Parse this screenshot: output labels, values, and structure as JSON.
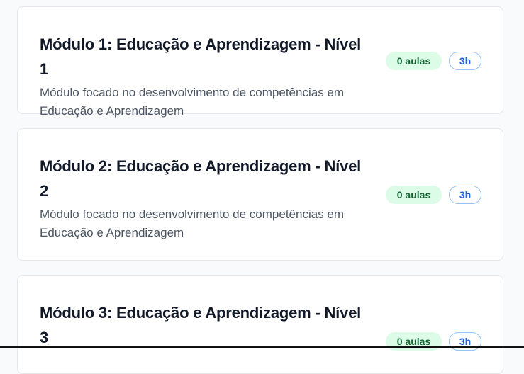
{
  "modules": [
    {
      "title": "Módulo 1: Educação e Aprendizagem - Nível 1",
      "description": "Módulo focado no desenvolvimento de competências em Educação e Aprendizagem",
      "lessons": "0 aulas",
      "duration": "3h"
    },
    {
      "title": "Módulo 2: Educação e Aprendizagem - Nível 2",
      "description": "Módulo focado no desenvolvimento de competências em Educação e Aprendizagem",
      "lessons": "0 aulas",
      "duration": "3h"
    },
    {
      "title": "Módulo 3: Educação e Aprendizagem - Nível 3",
      "description": "",
      "lessons": "0 aulas",
      "duration": "3h"
    }
  ],
  "colors": {
    "lessons_badge_bg": "#dcfce7",
    "lessons_badge_text": "#166534",
    "hours_badge_text": "#2563eb",
    "hours_badge_border": "#93c5fd"
  }
}
